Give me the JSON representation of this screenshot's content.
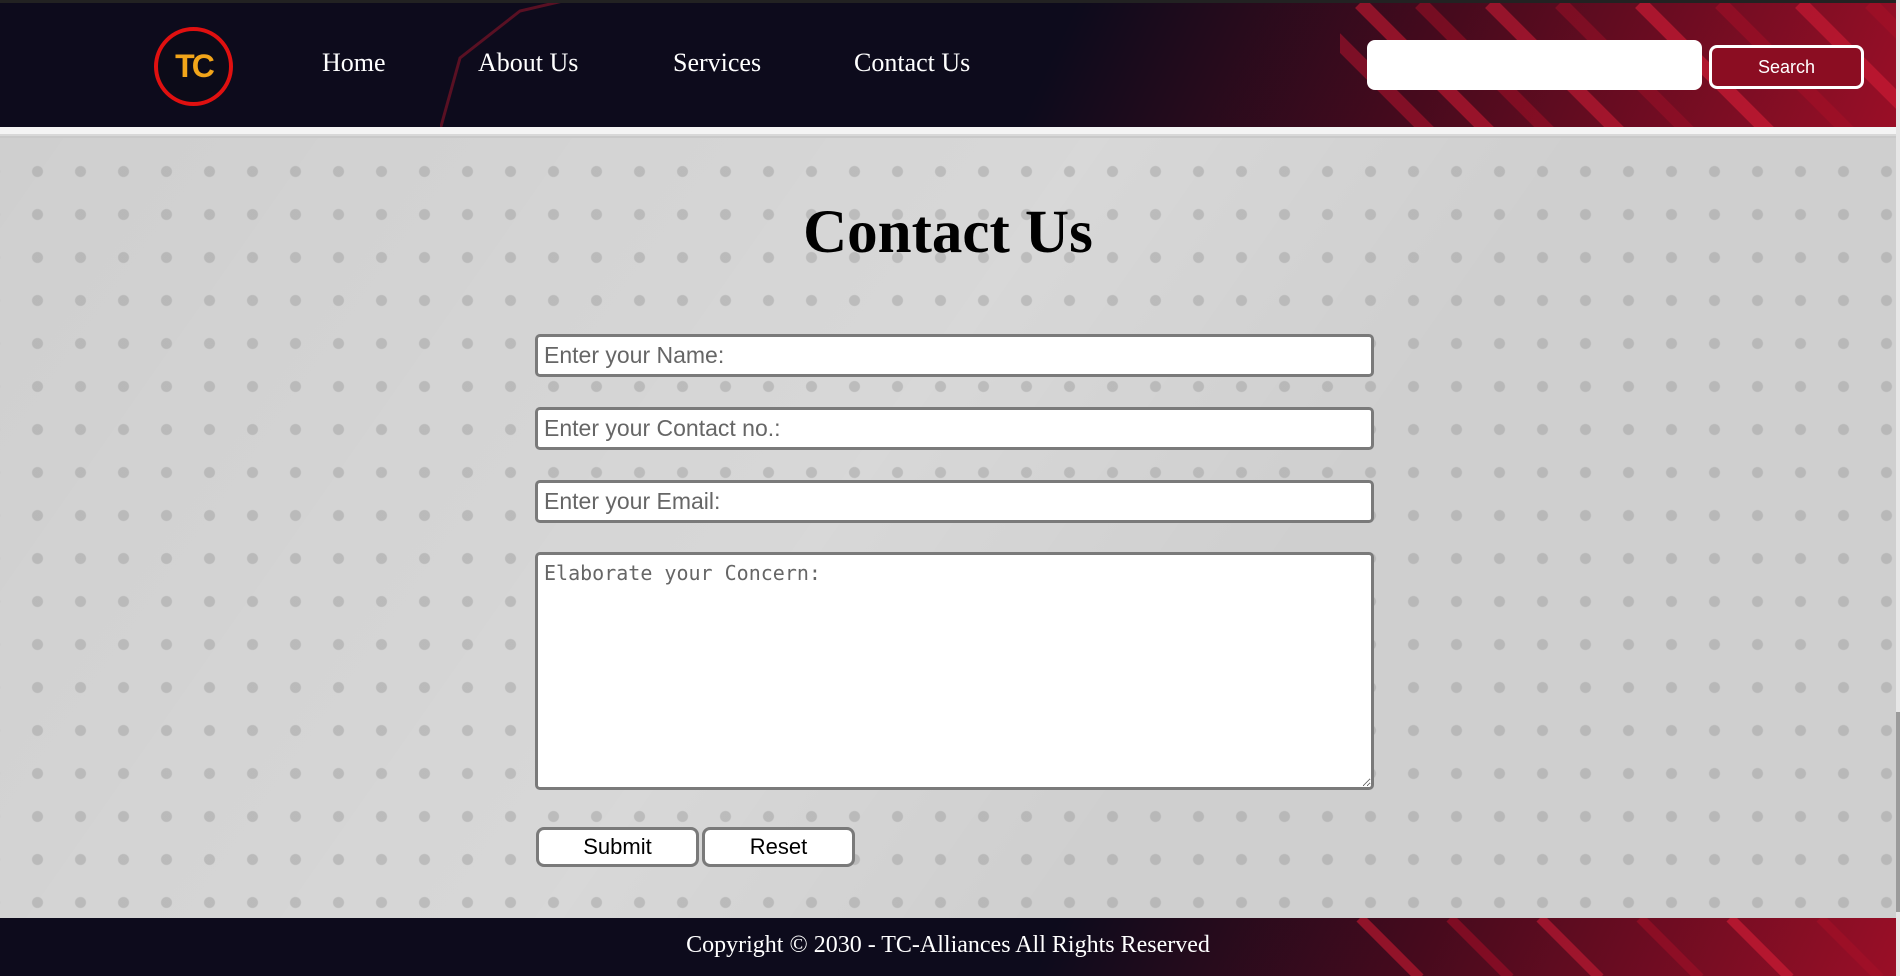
{
  "header": {
    "logo_text": "TC",
    "nav": [
      {
        "label": "Home"
      },
      {
        "label": "About Us"
      },
      {
        "label": "Services"
      },
      {
        "label": "Contact Us"
      }
    ],
    "search": {
      "value": "",
      "button_label": "Search"
    }
  },
  "main": {
    "title": "Contact Us",
    "form": {
      "name_placeholder": "Enter your Name:",
      "contact_placeholder": "Enter your Contact no.:",
      "email_placeholder": "Enter your Email:",
      "concern_placeholder": "Elaborate your Concern:",
      "submit_label": "Submit",
      "reset_label": "Reset"
    }
  },
  "footer": {
    "text": "Copyright © 2030 - TC-Alliances All Rights Reserved"
  },
  "colors": {
    "header_bg": "#0d0b1c",
    "accent_red": "#8b0d22",
    "logo_ring": "#e01010",
    "logo_text": "#f2a51a",
    "page_bg": "#cfcfcf"
  }
}
